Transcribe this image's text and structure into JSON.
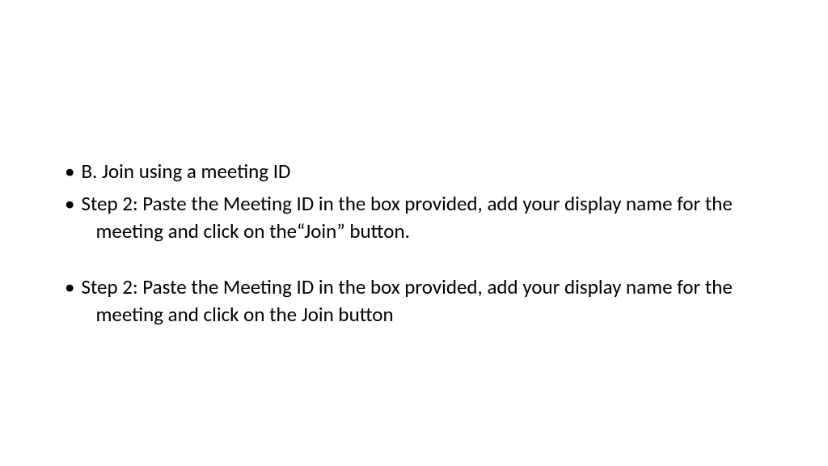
{
  "bullets": {
    "item1": "B. Join using a meeting ID",
    "item2": "Step 2: Paste the Meeting ID in the box provided, add your display name for the meeting and click on the“Join” button.",
    "item3": "Step 2: Paste the Meeting ID in the box provided, add your display name for the meeting and click on the Join button"
  },
  "marker": "•"
}
